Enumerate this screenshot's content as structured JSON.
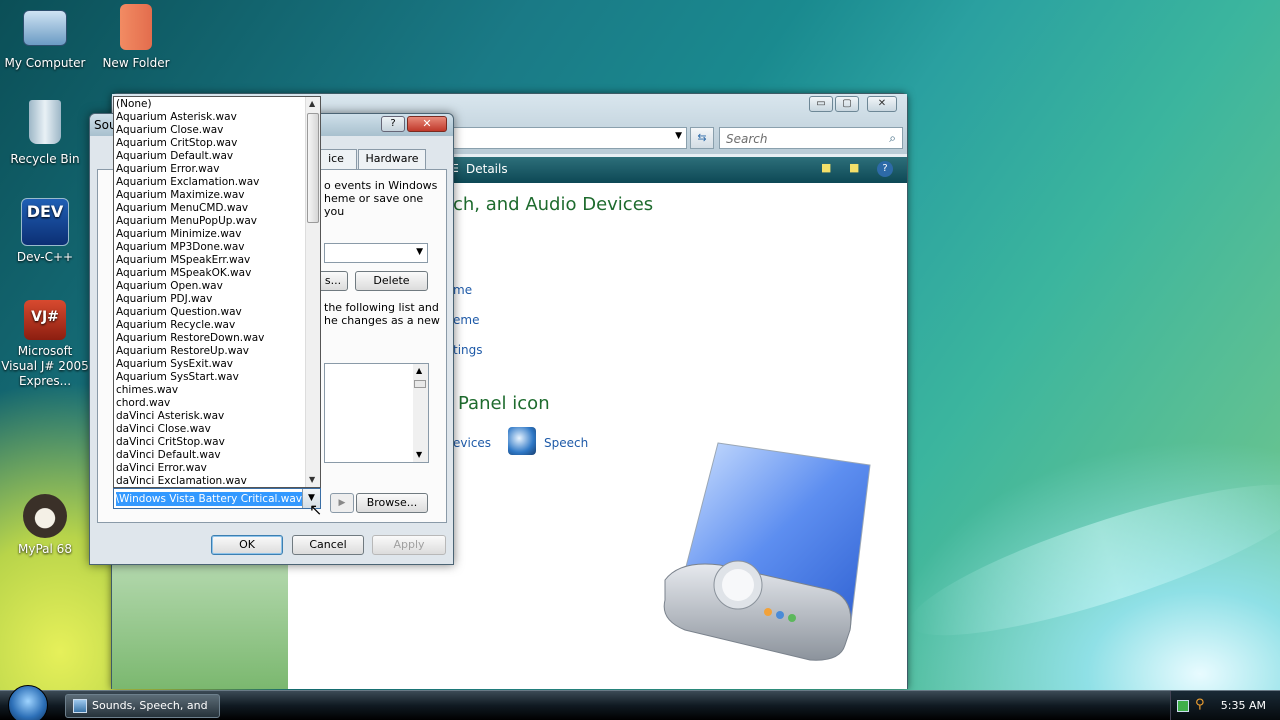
{
  "desktop": {
    "icons": [
      {
        "label": "My Computer"
      },
      {
        "label": "New Folder"
      },
      {
        "label": "Recycle Bin"
      },
      {
        "label": "Dev-C++"
      },
      {
        "label": "Microsoft Visual J# 2005 Expres..."
      },
      {
        "label": "MyPal 68"
      }
    ]
  },
  "control_panel": {
    "search_placeholder": "Search",
    "details_label": "Details",
    "heading_1": "ch, and Audio Devices",
    "heading_2": "Panel icon",
    "links": [
      "me",
      "eme",
      "tings"
    ],
    "devices_link": "evices",
    "speech_link": "Speech"
  },
  "sounds_dialog": {
    "title": "Sou",
    "tabs": [
      "ice",
      "Hardware"
    ],
    "text1_line1": "o events in Windows",
    "text1_line2": "heme or save one you",
    "text2_line1": "the following list and",
    "text2_line2": "he changes as a new",
    "save_as_btn": "s...",
    "delete_btn": "Delete",
    "browse_btn": "Browse...",
    "ok_btn": "OK",
    "cancel_btn": "Cancel",
    "apply_btn": "Apply",
    "selected_sound": "sta\\Windows Vista Battery Critical.wav"
  },
  "sound_list": [
    "(None)",
    "Aquarium Asterisk.wav",
    "Aquarium Close.wav",
    "Aquarium CritStop.wav",
    "Aquarium Default.wav",
    "Aquarium Error.wav",
    "Aquarium Exclamation.wav",
    "Aquarium Maximize.wav",
    "Aquarium MenuCMD.wav",
    "Aquarium MenuPopUp.wav",
    "Aquarium Minimize.wav",
    "Aquarium MP3Done.wav",
    "Aquarium MSpeakErr.wav",
    "Aquarium MSpeakOK.wav",
    "Aquarium Open.wav",
    "Aquarium PDJ.wav",
    "Aquarium Question.wav",
    "Aquarium Recycle.wav",
    "Aquarium RestoreDown.wav",
    "Aquarium RestoreUp.wav",
    "Aquarium SysExit.wav",
    "Aquarium SysStart.wav",
    "chimes.wav",
    "chord.wav",
    "daVinci Asterisk.wav",
    "daVinci Close.wav",
    "daVinci CritStop.wav",
    "daVinci Default.wav",
    "daVinci Error.wav",
    "daVinci Exclamation.wav"
  ],
  "taskbar": {
    "task_label": "Sounds, Speech, and ...",
    "clock": "5:35 AM"
  },
  "colors": {
    "accent_green": "#1e6b2e",
    "link_blue": "#1e5aa8",
    "selection": "#3399ff"
  }
}
